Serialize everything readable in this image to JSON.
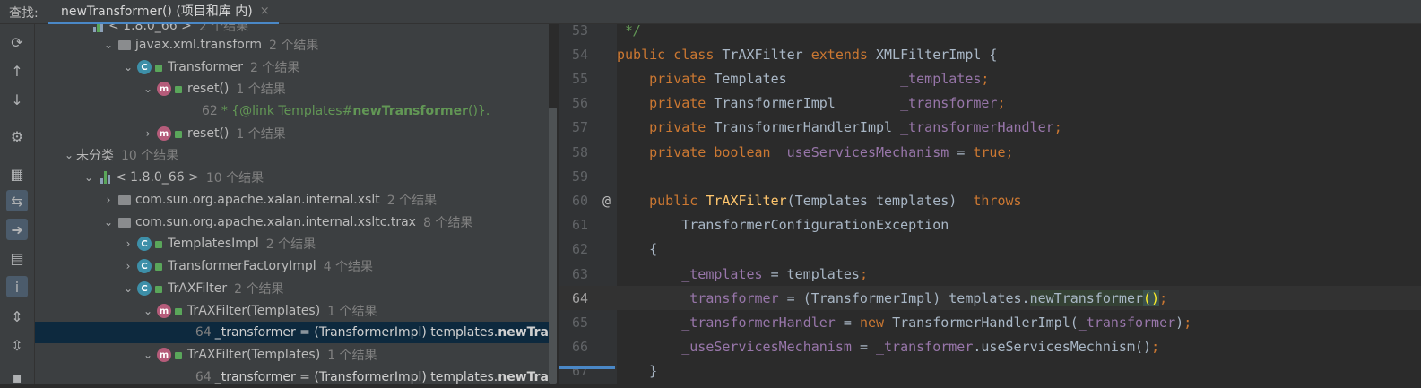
{
  "find_bar": {
    "label": "查找:",
    "tab_title": "newTransformer() (项目和库 内)",
    "close_glyph": "×"
  },
  "toolbar_icons": [
    "rerun-icon",
    "up-arrow-icon",
    "down-arrow-icon",
    "settings-icon",
    "group-icon",
    "import-icon",
    "export-icon",
    "preview-icon",
    "info-icon",
    "expand-all-icon",
    "collapse-all-icon"
  ],
  "tree": [
    {
      "indent": 60,
      "chev": "",
      "icon": "lib",
      "label": "< 1.8.0_66 >",
      "count": "2 个结果",
      "partial": true
    },
    {
      "indent": 74,
      "chev": "v",
      "icon": "pkg",
      "label": "javax.xml.transform",
      "count": "2 个结果"
    },
    {
      "indent": 96,
      "chev": "v",
      "icon": "c",
      "label": "Transformer",
      "count": "2 个结果"
    },
    {
      "indent": 118,
      "chev": "v",
      "icon": "m",
      "label": "reset()",
      "count": "1 个结果"
    },
    {
      "indent": 186,
      "chev": "",
      "icon": "",
      "line": "62",
      "comment_pre": "* {@link Templates#",
      "comment_bold": "newTransformer",
      "comment_post": "()}."
    },
    {
      "indent": 118,
      "chev": ">",
      "icon": "m",
      "label": "reset()",
      "count": "1 个结果"
    },
    {
      "indent": 30,
      "chev": "v",
      "icon": "",
      "label": "未分类",
      "count": "10 个结果"
    },
    {
      "indent": 52,
      "chev": "v",
      "icon": "lib",
      "label": "< 1.8.0_66 >",
      "count": "10 个结果"
    },
    {
      "indent": 74,
      "chev": ">",
      "icon": "pkg",
      "label": "com.sun.org.apache.xalan.internal.xslt",
      "count": "2 个结果"
    },
    {
      "indent": 74,
      "chev": "v",
      "icon": "pkg",
      "label": "com.sun.org.apache.xalan.internal.xsltc.trax",
      "count": "8 个结果"
    },
    {
      "indent": 96,
      "chev": ">",
      "icon": "c",
      "label": "TemplatesImpl",
      "count": "2 个结果"
    },
    {
      "indent": 96,
      "chev": ">",
      "icon": "c",
      "label": "TransformerFactoryImpl",
      "count": "4 个结果"
    },
    {
      "indent": 96,
      "chev": "v",
      "icon": "c",
      "label": "TrAXFilter",
      "count": "2 个结果"
    },
    {
      "indent": 118,
      "chev": "v",
      "icon": "m",
      "label": "TrAXFilter(Templates)",
      "count": "1 个结果"
    },
    {
      "indent": 186,
      "chev": "",
      "icon": "",
      "line": "64",
      "usage_pre": "_transformer = (TransformerImpl) templates.",
      "usage_bold": "newTra",
      "selected": true
    },
    {
      "indent": 118,
      "chev": "v",
      "icon": "m",
      "label": "TrAXFilter(Templates)",
      "count": "1 个结果"
    },
    {
      "indent": 186,
      "chev": "",
      "icon": "",
      "line": "64",
      "usage_pre": "_transformer = (TransformerImpl) templates.",
      "usage_bold": "newTra",
      "partial": true
    }
  ],
  "editor": {
    "lines": [
      {
        "num": "53",
        "html": "<span class=\"doc\"> */</span>"
      },
      {
        "num": "54",
        "html": "<span class=\"kw\">public class </span>TrAXFilter <span class=\"kw\">extends </span>XMLFilterImpl {"
      },
      {
        "num": "55",
        "html": "    <span class=\"kw\">private </span>Templates              <span class=\"fld\">_templates</span><span class=\"kw\">;</span>"
      },
      {
        "num": "56",
        "html": "    <span class=\"kw\">private </span>TransformerImpl        <span class=\"fld\">_transformer</span><span class=\"kw\">;</span>"
      },
      {
        "num": "57",
        "html": "    <span class=\"kw\">private </span>TransformerHandlerImpl <span class=\"fld\">_transformerHandler</span><span class=\"kw\">;</span>"
      },
      {
        "num": "58",
        "html": "    <span class=\"kw\">private boolean </span><span class=\"fld\">_useServicesMechanism </span>= <span class=\"kw\">true;</span>"
      },
      {
        "num": "59",
        "html": ""
      },
      {
        "num": "60",
        "mark": "@",
        "html": "    <span class=\"kw\">public </span><span class=\"fn\">TrAXFilter</span>(Templates templates)  <span class=\"kw\">throws</span>"
      },
      {
        "num": "61",
        "html": "        TransformerConfigurationException"
      },
      {
        "num": "62",
        "html": "    {"
      },
      {
        "num": "63",
        "html": "        <span class=\"fld\">_templates </span>= templates<span class=\"kw\">;</span>"
      },
      {
        "num": "64",
        "current": true,
        "html": "        <span class=\"fld\">_transformer </span>= (TransformerImpl) templates.<span class=\"hl\">newTransformer</span><span class=\"paren\">()</span><span class=\"kw\">;</span>"
      },
      {
        "num": "65",
        "html": "        <span class=\"fld\">_transformerHandler </span>= <span class=\"kw\">new </span>TransformerHandlerImpl(<span class=\"fld\">_transformer</span>)<span class=\"kw\">;</span>"
      },
      {
        "num": "66",
        "html": "        <span class=\"fld\">_useServicesMechanism </span>= <span class=\"fld\">_transformer</span>.useServicesMechnism()<span class=\"kw\">;</span>"
      },
      {
        "num": "67",
        "html": "    }",
        "partial": true
      }
    ]
  }
}
